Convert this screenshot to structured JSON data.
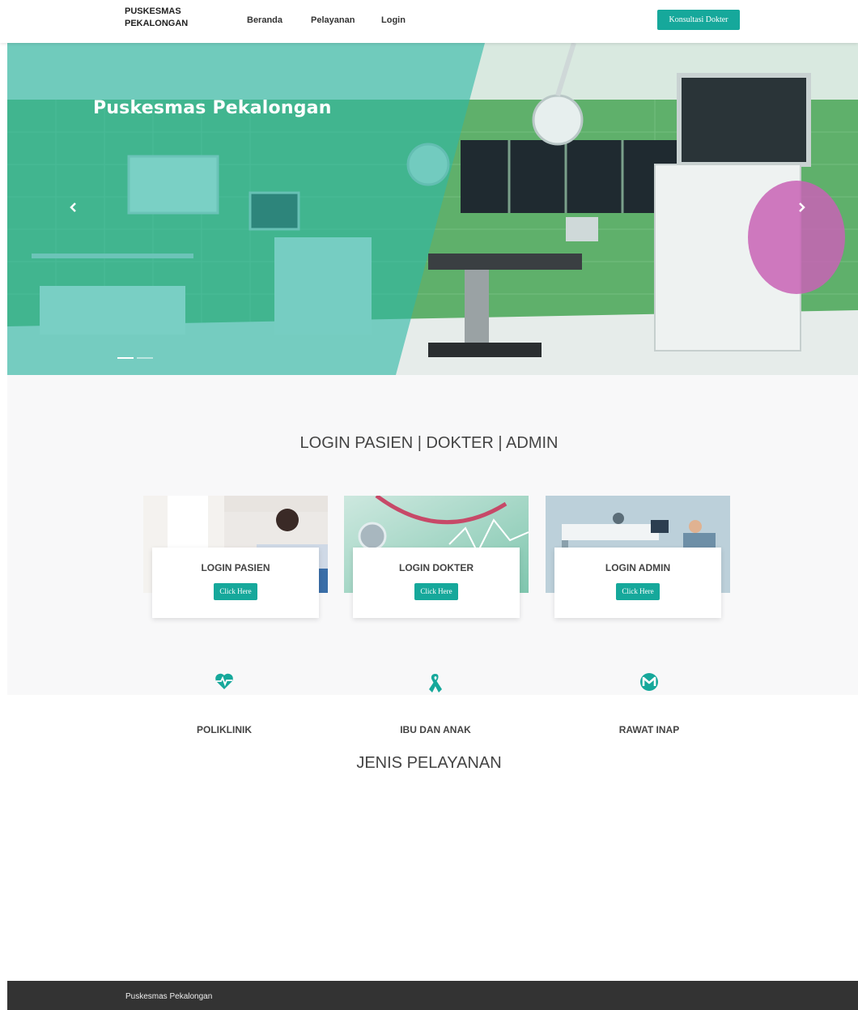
{
  "navbar": {
    "brand": "PUSKESMAS PEKALONGAN",
    "links": [
      "Beranda",
      "Pelayanan",
      "Login"
    ],
    "cta_label": "Konsultasi Dokter"
  },
  "hero": {
    "title": "Puskesmas Pekalongan",
    "slide_count": 2,
    "active_slide": 1
  },
  "login_section": {
    "title": "LOGIN PASIEN | DOKTER | ADMIN",
    "cards": [
      {
        "title": "LOGIN PASIEN",
        "button": "Click Here"
      },
      {
        "title": "LOGIN DOKTER",
        "button": "Click Here"
      },
      {
        "title": "LOGIN ADMIN",
        "button": "Click Here"
      }
    ]
  },
  "services_section": {
    "title": "JENIS PELAYANAN",
    "items": [
      {
        "label": "POLIKLINIK",
        "icon": "heartbeat-icon"
      },
      {
        "label": "IBU DAN ANAK",
        "icon": "ribbon-icon"
      },
      {
        "label": "RAWAT INAP",
        "icon": "monero-icon"
      }
    ]
  },
  "footer": {
    "text": "Puskesmas Pekalongan"
  },
  "colors": {
    "accent": "#16a89b",
    "footer_bg": "#333333",
    "section_bg": "#f8f8f9"
  }
}
